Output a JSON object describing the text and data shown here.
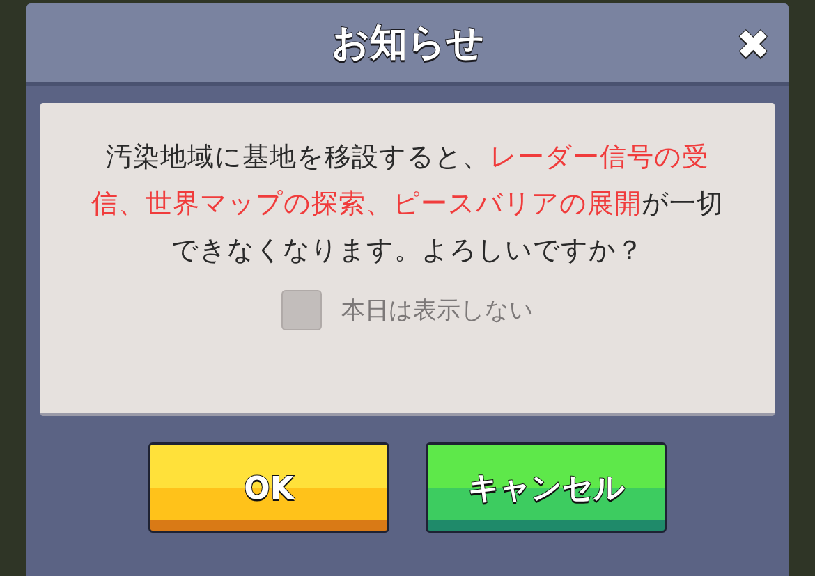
{
  "dialog": {
    "title": "お知らせ",
    "close": "✖",
    "message": [
      {
        "kind": "normal",
        "text": "汚染地域に基地を移設すると、"
      },
      {
        "kind": "highlight",
        "text": "レーダー信号の受信、世界マップの探索、ピースバリアの展開"
      },
      {
        "kind": "normal",
        "text": "が一切できなくなります。よろしいですか？"
      }
    ],
    "checkbox": {
      "label": "本日は表示しない",
      "checked": false
    },
    "buttons": [
      {
        "label": "OK",
        "kind": "confirm"
      },
      {
        "label": "キャンセル",
        "kind": "cancel"
      }
    ]
  }
}
